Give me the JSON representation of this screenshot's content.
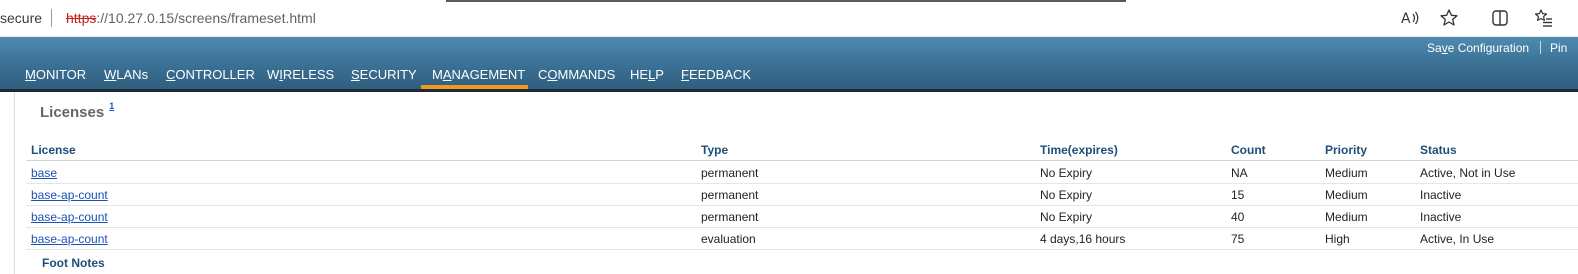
{
  "browser": {
    "secure_label": "secure",
    "url_scheme": "https",
    "url_rest": "://10.27.0.15/screens/frameset.html"
  },
  "header": {
    "save_configuration": "Save Configuration",
    "ping": "Pin",
    "nav": [
      {
        "pre": "",
        "u": "M",
        "post": "ONITOR"
      },
      {
        "pre": "",
        "u": "W",
        "post": "LANs"
      },
      {
        "pre": "",
        "u": "C",
        "post": "ONTROLLER"
      },
      {
        "pre": "W",
        "u": "I",
        "post": "RELESS"
      },
      {
        "pre": "",
        "u": "S",
        "post": "ECURITY"
      },
      {
        "pre": "M",
        "u": "A",
        "post": "NAGEMENT"
      },
      {
        "pre": "C",
        "u": "O",
        "post": "MMANDS"
      },
      {
        "pre": "HE",
        "u": "L",
        "post": "P"
      },
      {
        "pre": "",
        "u": "F",
        "post": "EEDBACK"
      }
    ],
    "active_nav": "MANAGEMENT",
    "accent_color": "#f09a1f"
  },
  "page": {
    "title": "Licenses",
    "footnote_ref": "1",
    "footnotes_label": "Foot Notes"
  },
  "table": {
    "columns": [
      "License",
      "Type",
      "Time(expires)",
      "Count",
      "Priority",
      "Status"
    ],
    "rows": [
      [
        "base",
        "permanent",
        "No Expiry",
        "NA",
        "Medium",
        "Active, Not in Use"
      ],
      [
        "base-ap-count",
        "permanent",
        "No Expiry",
        "15",
        "Medium",
        "Inactive"
      ],
      [
        "base-ap-count",
        "permanent",
        "No Expiry",
        "40",
        "Medium",
        "Inactive"
      ],
      [
        "base-ap-count",
        "evaluation",
        "4 days,16 hours",
        "75",
        "High",
        "Active, In Use"
      ]
    ]
  }
}
